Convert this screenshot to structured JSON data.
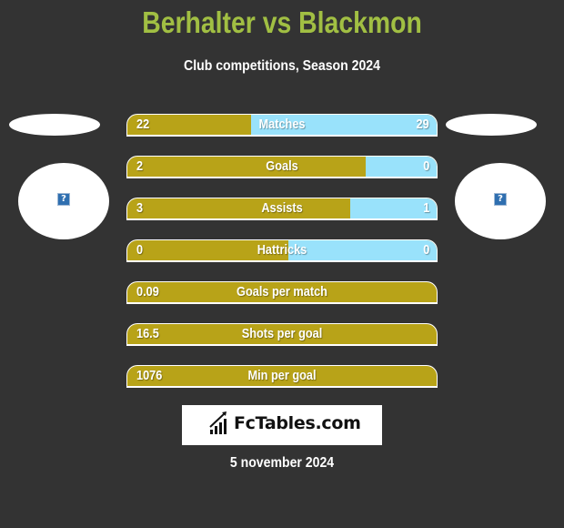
{
  "header": {
    "title": "Berhalter vs Blackmon",
    "subtitle": "Club competitions, Season 2024"
  },
  "players": {
    "left": {
      "avatar_icon": "broken-image-icon",
      "glyph": "?"
    },
    "right": {
      "avatar_icon": "broken-image-icon",
      "glyph": "?"
    }
  },
  "colors": {
    "title": "#a1bf43",
    "left_bar": "#b8a318",
    "right_bar": "#99e2fb",
    "background": "#333333"
  },
  "stats": [
    {
      "label": "Matches",
      "left": "22",
      "right": "29",
      "left_share": 0.4
    },
    {
      "label": "Goals",
      "left": "2",
      "right": "0",
      "left_share": 0.77
    },
    {
      "label": "Assists",
      "left": "3",
      "right": "1",
      "left_share": 0.72
    },
    {
      "label": "Hattricks",
      "left": "0",
      "right": "0",
      "left_share": 0.52
    },
    {
      "label": "Goals per match",
      "left": "0.09",
      "right": null,
      "left_share": 1.0
    },
    {
      "label": "Shots per goal",
      "left": "16.5",
      "right": null,
      "left_share": 1.0
    },
    {
      "label": "Min per goal",
      "left": "1076",
      "right": null,
      "left_share": 1.0
    }
  ],
  "footer": {
    "logo_text": "FcTables.com",
    "logo_icon": "bar-chart-icon",
    "date": "5 november 2024"
  }
}
